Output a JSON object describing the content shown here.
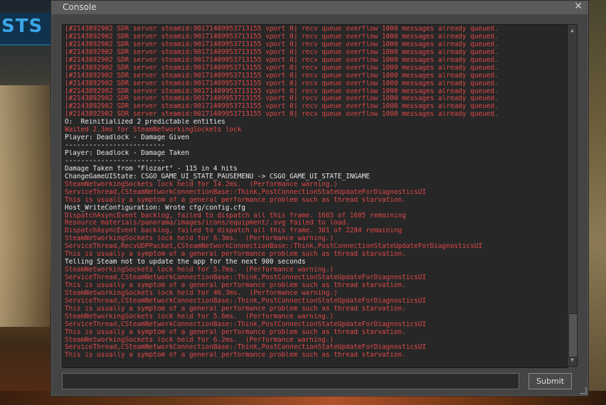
{
  "window": {
    "title": "Console",
    "close_icon": "close-icon"
  },
  "background": {
    "banner_text": "STS"
  },
  "log": [
    {
      "text": "[#2143892902 SDR server steamid:90171409953713155 vport 0] recv queue overflow 1000 messages already queued.",
      "type": "error"
    },
    {
      "text": "[#2143892902 SDR server steamid:90171409953713155 vport 0] recv queue overflow 1000 messages already queued.",
      "type": "error"
    },
    {
      "text": "[#2143892902 SDR server steamid:90171409953713155 vport 0] recv queue overflow 1000 messages already queued.",
      "type": "error"
    },
    {
      "text": "[#2143892902 SDR server steamid:90171409953713155 vport 0] recv queue overflow 1000 messages already queued.",
      "type": "error"
    },
    {
      "text": "[#2143892902 SDR server steamid:90171409953713155 vport 0] recv queue overflow 1000 messages already queued.",
      "type": "error"
    },
    {
      "text": "[#2143892902 SDR server steamid:90171409953713155 vport 0] recv queue overflow 1000 messages already queued.",
      "type": "error"
    },
    {
      "text": "[#2143892902 SDR server steamid:90171409953713155 vport 0] recv queue overflow 1000 messages already queued.",
      "type": "error"
    },
    {
      "text": "[#2143892902 SDR server steamid:90171409953713155 vport 0] recv queue overflow 1000 messages already queued.",
      "type": "error"
    },
    {
      "text": "[#2143892902 SDR server steamid:90171409953713155 vport 0] recv queue overflow 1000 messages already queued.",
      "type": "error"
    },
    {
      "text": "[#2143892902 SDR server steamid:90171409953713155 vport 0] recv queue overflow 1000 messages already queued.",
      "type": "error"
    },
    {
      "text": "[#2143892902 SDR server steamid:90171409953713155 vport 0] recv queue overflow 1000 messages already queued.",
      "type": "error"
    },
    {
      "text": "[#2143892902 SDR server steamid:90171409953713155 vport 0] recv queue overflow 1000 messages already queued.",
      "type": "error"
    },
    {
      "text": "O:  Reinitialized 2 predictable entities",
      "type": "normal"
    },
    {
      "text": "Waited 2.3ms for SteamNetworkingSockets lock",
      "type": "error"
    },
    {
      "text": "Player: Deadlock - Damage Given",
      "type": "normal"
    },
    {
      "text": "-------------------------",
      "type": "normal"
    },
    {
      "text": "Player: Deadlock - Damage Taken",
      "type": "normal"
    },
    {
      "text": "-------------------------",
      "type": "normal"
    },
    {
      "text": "Damage Taken from \"Flozart\" - 115 in 4 hits",
      "type": "normal"
    },
    {
      "text": "ChangeGameUIState: CSGO_GAME_UI_STATE_PAUSEMENU -> CSGO_GAME_UI_STATE_INGAME",
      "type": "normal"
    },
    {
      "text": "SteamNetworkingSockets lock held for 14.2ms.  (Performance warning.)",
      "type": "error"
    },
    {
      "text": "ServiceThread,CSteamNetworkConnectionBase::Think,PostConnectionStateUpdateForDiagnosticsUI",
      "type": "error"
    },
    {
      "text": "This is usually a symptom of a general performance problem such as thread starvation.",
      "type": "error"
    },
    {
      "text": "Host_WriteConfiguration: Wrote cfg/config.cfg",
      "type": "normal"
    },
    {
      "text": "DispatchAsyncEvent backlog, failed to dispatch all this frame. 1603 of 1605 remaining",
      "type": "error"
    },
    {
      "text": "Resource materials/panorama/images/icons/equipment/.svg failed to load.",
      "type": "error"
    },
    {
      "text": "DispatchAsyncEvent backlog, failed to dispatch all this frame. 301 of 2284 remaining",
      "type": "error"
    },
    {
      "text": "SteamNetworkingSockets lock held for 6.3ms.  (Performance warning.)",
      "type": "error"
    },
    {
      "text": "ServiceThread,RecvUDPPacket,CSteamNetworkConnectionBase::Think,PostConnectionStateUpdateForDiagnosticsUI",
      "type": "error"
    },
    {
      "text": "This is usually a symptom of a general performance problem such as thread starvation.",
      "type": "error"
    },
    {
      "text": "Telling Steam not to update the app for the next 900 seconds",
      "type": "normal"
    },
    {
      "text": "SteamNetworkingSockets lock held for 5.7ms.  (Performance warning.)",
      "type": "error"
    },
    {
      "text": "ServiceThread,CSteamNetworkConnectionBase::Think,PostConnectionStateUpdateForDiagnosticsUI",
      "type": "error"
    },
    {
      "text": "This is usually a symptom of a general performance problem such as thread starvation.",
      "type": "error"
    },
    {
      "text": "SteamNetworkingSockets lock held for 46.3ms.  (Performance warning.)",
      "type": "error"
    },
    {
      "text": "ServiceThread,CSteamNetworkConnectionBase::Think,PostConnectionStateUpdateForDiagnosticsUI",
      "type": "error"
    },
    {
      "text": "This is usually a symptom of a general performance problem such as thread starvation.",
      "type": "error"
    },
    {
      "text": "SteamNetworkingSockets lock held for 5.6ms.  (Performance warning.)",
      "type": "error"
    },
    {
      "text": "ServiceThread,CSteamNetworkConnectionBase::Think,PostConnectionStateUpdateForDiagnosticsUI",
      "type": "error"
    },
    {
      "text": "This is usually a symptom of a general performance problem such as thread starvation.",
      "type": "error"
    },
    {
      "text": "SteamNetworkingSockets lock held for 6.2ms.  (Performance warning.)",
      "type": "error"
    },
    {
      "text": "ServiceThread,CSteamNetworkConnectionBase::Think,PostConnectionStateUpdateForDiagnosticsUI",
      "type": "error"
    },
    {
      "text": "This is usually a symptom of a general performance problem such as thread starvation.",
      "type": "error"
    }
  ],
  "colors": {
    "error": "#e04848",
    "normal": "#e8e8e8"
  },
  "input": {
    "value": "",
    "placeholder": ""
  },
  "submit_label": "Submit",
  "scrollbar": {
    "up_icon": "scroll-up-arrow-icon",
    "down_icon": "scroll-down-arrow-icon"
  }
}
